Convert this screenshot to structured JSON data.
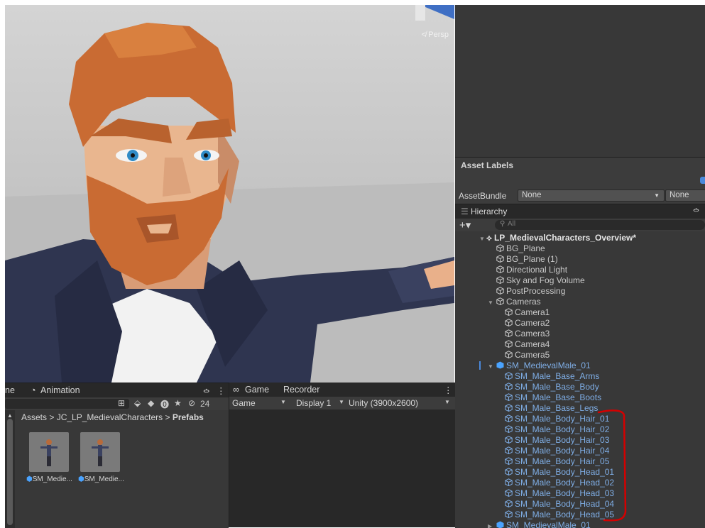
{
  "scene": {
    "persp_label": "≮ Persp"
  },
  "asset_labels": {
    "title": "Asset Labels",
    "assetbundle_label": "AssetBundle",
    "assetbundle_value": "None",
    "variant_value": "None"
  },
  "hierarchy": {
    "tab_label": "Hierarchy",
    "search_placeholder": "All",
    "root": "LP_MedievalCharacters_Overview*",
    "items": [
      {
        "label": "BG_Plane"
      },
      {
        "label": "BG_Plane (1)"
      },
      {
        "label": "Directional Light"
      },
      {
        "label": "Sky and Fog Volume"
      },
      {
        "label": "PostProcessing"
      },
      {
        "label": "Cameras"
      },
      {
        "label": "Camera1"
      },
      {
        "label": "Camera2"
      },
      {
        "label": "Camera3"
      },
      {
        "label": "Camera4"
      },
      {
        "label": "Camera5"
      },
      {
        "label": "SM_MedievalMale_01"
      },
      {
        "label": "SM_Male_Base_Arms"
      },
      {
        "label": "SM_Male_Base_Body"
      },
      {
        "label": "SM_Male_Base_Boots"
      },
      {
        "label": "SM_Male_Base_Legs"
      },
      {
        "label": "SM_Male_Body_Hair_01"
      },
      {
        "label": "SM_Male_Body_Hair_02"
      },
      {
        "label": "SM_Male_Body_Hair_03"
      },
      {
        "label": "SM_Male_Body_Hair_04"
      },
      {
        "label": "SM_Male_Body_Hair_05"
      },
      {
        "label": "SM_Male_Body_Head_01"
      },
      {
        "label": "SM_Male_Body_Head_02"
      },
      {
        "label": "SM_Male_Body_Head_03"
      },
      {
        "label": "SM_Male_Body_Head_04"
      },
      {
        "label": "SM_Male_Body_Head_05"
      },
      {
        "label": "SM_MedievalMale_01"
      }
    ]
  },
  "project": {
    "tab_partial": "ne",
    "animation_tab": "Animation",
    "hidden_count": "24",
    "breadcrumb": {
      "part1": "Assets",
      "sep": ">",
      "part2": "JC_LP_MedievalCharacters",
      "part3": "Prefabs"
    },
    "assets": [
      {
        "label": "SM_Medie..."
      },
      {
        "label": "SM_Medie..."
      }
    ]
  },
  "game": {
    "game_tab": "Game",
    "recorder_tab": "Recorder",
    "mode_value": "Game",
    "display_value": "Display 1",
    "resolution_value": "Unity (3900x2600)"
  },
  "colors": {
    "hierarchy_blue": "#7faee6",
    "annotation_red": "#d40000",
    "panel": "#383838"
  }
}
